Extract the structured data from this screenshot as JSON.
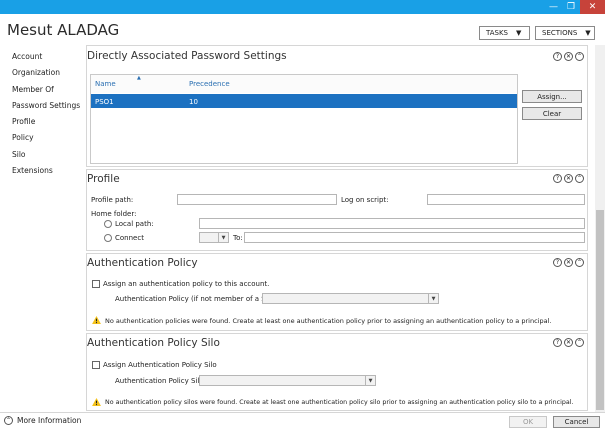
{
  "window": {
    "title": "Mesut ALADAG",
    "min_glyph": "—",
    "max_glyph": "❐",
    "close_glyph": "✕"
  },
  "header": {
    "tasks_label": "TASKS",
    "sections_label": "SECTIONS"
  },
  "nav": {
    "items": [
      "Account",
      "Organization",
      "Member Of",
      "Password Settings",
      "Profile",
      "Policy",
      "Silo",
      "Extensions"
    ]
  },
  "pso": {
    "title": "Directly Associated Password Settings",
    "columns": [
      "Name",
      "Precedence"
    ],
    "rows": [
      {
        "name": "PSO1",
        "precedence": "10"
      }
    ],
    "assign_label": "Assign...",
    "clear_label": "Clear"
  },
  "profile": {
    "title": "Profile",
    "profile_path_label": "Profile path:",
    "logon_script_label": "Log on script:",
    "home_folder_label": "Home folder:",
    "local_path_label": "Local path:",
    "connect_label": "Connect",
    "to_label": "To:"
  },
  "auth_policy": {
    "title": "Authentication Policy",
    "assign_checkbox_label": "Assign an authentication policy to this account.",
    "policy_label": "Authentication Policy (if not member of a Silo):",
    "warning": "No authentication policies were found. Create at least one authentication policy prior to assigning an authentication policy to a principal."
  },
  "auth_silo": {
    "title": "Authentication Policy Silo",
    "assign_checkbox_label": "Assign Authentication Policy Silo",
    "silo_label": "Authentication Policy Silo:",
    "warning": "No authentication policy silos were found. Create at least one authentication policy silo prior to assigning an authentication policy silo to a principal."
  },
  "section_controls": {
    "help": "?",
    "close": "✕",
    "collapse": "⌃"
  },
  "footer": {
    "more_info_label": "More Information",
    "more_glyph": "⌃",
    "ok_label": "OK",
    "cancel_label": "Cancel"
  },
  "colors": {
    "accent": "#19a0e6",
    "selection": "#1c71c1",
    "close_red": "#c7433a",
    "warning": "#f4c21a"
  }
}
